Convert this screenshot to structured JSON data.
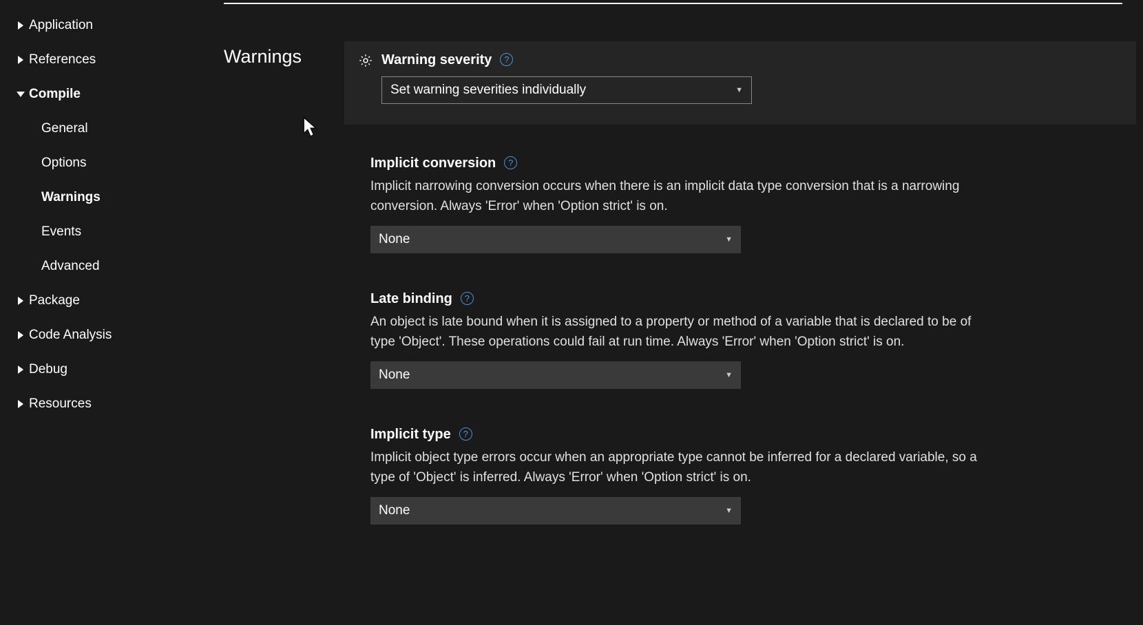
{
  "sidebar": {
    "items": [
      {
        "label": "Application",
        "expanded": false,
        "sub": false
      },
      {
        "label": "References",
        "expanded": false,
        "sub": false
      },
      {
        "label": "Compile",
        "expanded": true,
        "sub": false
      },
      {
        "label": "General",
        "sub": true,
        "active": false
      },
      {
        "label": "Options",
        "sub": true,
        "active": false
      },
      {
        "label": "Warnings",
        "sub": true,
        "active": true
      },
      {
        "label": "Events",
        "sub": true,
        "active": false
      },
      {
        "label": "Advanced",
        "sub": true,
        "active": false
      },
      {
        "label": "Package",
        "expanded": false,
        "sub": false
      },
      {
        "label": "Code Analysis",
        "expanded": false,
        "sub": false
      },
      {
        "label": "Debug",
        "expanded": false,
        "sub": false
      },
      {
        "label": "Resources",
        "expanded": false,
        "sub": false
      }
    ]
  },
  "section": {
    "title": "Warnings",
    "severity": {
      "label": "Warning severity",
      "value": "Set warning severities individually"
    },
    "settings": [
      {
        "label": "Implicit conversion",
        "description": "Implicit narrowing conversion occurs when there is an implicit data type conversion that is a narrowing conversion. Always 'Error' when 'Option strict' is on.",
        "value": "None"
      },
      {
        "label": "Late binding",
        "description": "An object is late bound when it is assigned to a property or method of a variable that is declared to be of type 'Object'. These operations could fail at run time. Always 'Error' when 'Option strict' is on.",
        "value": "None"
      },
      {
        "label": "Implicit type",
        "description": "Implicit object type errors occur when an appropriate type cannot be inferred for a declared variable, so a type of 'Object' is inferred. Always 'Error' when 'Option strict' is on.",
        "value": "None"
      }
    ]
  },
  "glyphs": {
    "help": "?"
  }
}
